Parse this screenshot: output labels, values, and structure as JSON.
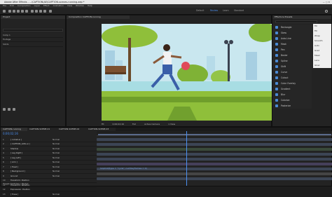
{
  "app": {
    "title": "Adobe After Effects - ...\\CAPTION\\AE\\CAPTION-scenes-running.aep *"
  },
  "menu": [
    "File",
    "Edit",
    "Composition",
    "Layer",
    "Effect",
    "Animation",
    "View",
    "Window",
    "Help"
  ],
  "workspaces": [
    "Default",
    "Review",
    "Learn",
    "Standard"
  ],
  "project_panel": {
    "tab": "Project",
    "search_placeholder": "",
    "items": [
      "Comp 1",
      "Footage",
      "Solids"
    ]
  },
  "comp_viewer": {
    "tab": "Composition CAPTION-running",
    "zoom": "Fit",
    "quality": "Full",
    "camera": "Active Camera",
    "views": "1 View",
    "timecode": "0;00;02;16"
  },
  "effects_panel": {
    "tab": "Effects & Presets",
    "items": [
      "Rectangle",
      "Skew",
      "Auto-Line",
      "Mask",
      "Pen",
      "Bezier",
      "Spline",
      "Shift",
      "Curve",
      "Cutout",
      "Color Overlay",
      "Gradient",
      "Blur",
      "Colorize",
      "Posterize"
    ],
    "right_items": [
      "Fill",
      "Fill",
      "Wrap",
      "Smooth",
      "Auto",
      "Grad",
      "Mask",
      "Lens",
      "Glow"
    ]
  },
  "timeline": {
    "tabs": [
      "CAPTION-running",
      "CAPTION-SCENE-01",
      "CAPTION-SCENE-02",
      "CAPTION-SCENE-03"
    ],
    "timecode": "0;00;02;16",
    "layers": [
      {
        "num": "1",
        "name": "[ rocket.ai ]",
        "mode": "Normal"
      },
      {
        "num": "2",
        "name": "[ CAPTION_GIRL.ai ]",
        "mode": "Normal"
      },
      {
        "num": "3",
        "name": "Shadow",
        "mode": "Normal"
      },
      {
        "num": "4",
        "name": "[ Leg Right ]",
        "mode": "Normal"
      },
      {
        "num": "5",
        "name": "[ Leg Left ]",
        "mode": "Normal"
      },
      {
        "num": "6",
        "name": "[ Arm ]",
        "mode": "Normal"
      },
      {
        "num": "7",
        "name": "[ Head ]",
        "mode": "Normal"
      },
      {
        "num": "8",
        "name": "[ Background ]",
        "mode": "Normal"
      },
      {
        "num": "9",
        "name": "Ground",
        "mode": "Normal"
      },
      {
        "num": "10",
        "name": "Transform: Position",
        "mode": ""
      },
      {
        "num": "11",
        "name": "Transform: Rotation",
        "mode": ""
      },
      {
        "num": "12",
        "name": "Expression: Position",
        "mode": ""
      },
      {
        "num": "13",
        "name": "[ Trees ]",
        "mode": "Normal"
      }
    ],
    "expression": "loopOut(type = \"cycle\", numKeyframes = 0)",
    "footer": "Toggle Switches / Modes"
  },
  "colors": {
    "accent": "#4b8ff0",
    "sky": "#c9e7ef",
    "grass": "#8fbf3a",
    "label_blue": "#4a8ad4"
  }
}
